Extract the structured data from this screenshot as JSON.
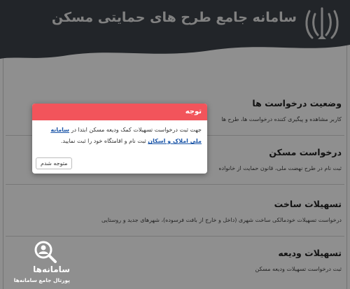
{
  "header": {
    "title": "سامانه جامع طرح های حمایتی مسکن"
  },
  "sections": [
    {
      "title": "وضعیت درخواست ها",
      "description": "کاربر مشاهده و پیگیری کننده درخواست ها، طرح ها"
    },
    {
      "title": "درخواست مسکن",
      "description": "ثبت نام در طرح نهضت ملی، قانون حمایت از خانواده"
    },
    {
      "title": "تسهیلات ساخت",
      "description": "درخواست تسهیلات خودمالکی ساخت شهری (داخل و خارج از بافت فرسوده)، شهرهای جدید و روستایی"
    },
    {
      "title": "تسهیلات ودیعه",
      "description": "ثبت درخواست تسهیلات ودیعه مسکن"
    }
  ],
  "modal": {
    "title": "توجه",
    "text_before": "جهت ثبت درخواست تسهیلات کمک ودیعه مسکن ابتدا در",
    "link": "سامانه ملی املاک و اسکان",
    "text_after": "ثبت نام و اقامتگاه خود را ثبت نمایید.",
    "button": "متوجه شدم"
  },
  "watermark": {
    "name": "سامانه‌ها",
    "subtitle": "پورتال جامع سامانه‌ها"
  },
  "colors": {
    "header_bg": "#3d4349",
    "modal_header": "#f2545b",
    "link": "#1a55a8"
  }
}
